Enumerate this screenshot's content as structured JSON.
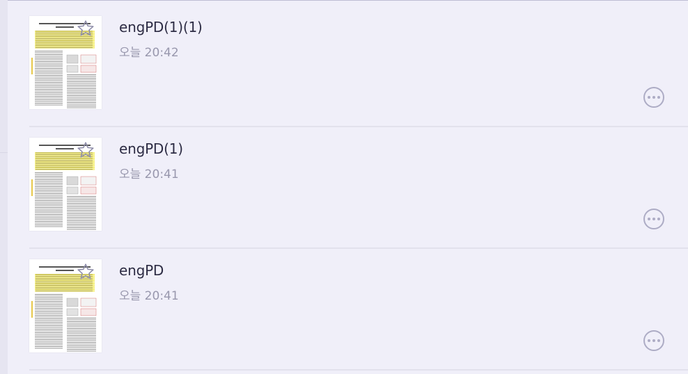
{
  "files": [
    {
      "title": "engPD(1)(1)",
      "time": "오늘 20:42",
      "favorite_icon": "star-outline-icon",
      "menu_icon": "more-horizontal-icon"
    },
    {
      "title": "engPD(1)",
      "time": "오늘 20:41",
      "favorite_icon": "star-outline-icon",
      "menu_icon": "more-horizontal-icon"
    },
    {
      "title": "engPD",
      "time": "오늘 20:41",
      "favorite_icon": "star-outline-icon",
      "menu_icon": "more-horizontal-icon"
    }
  ],
  "colors": {
    "background": "#f0eff9",
    "title_text": "#2d2c44",
    "time_text": "#9897ad",
    "icon": "#adacc5",
    "highlight": "#f5ef7a"
  }
}
